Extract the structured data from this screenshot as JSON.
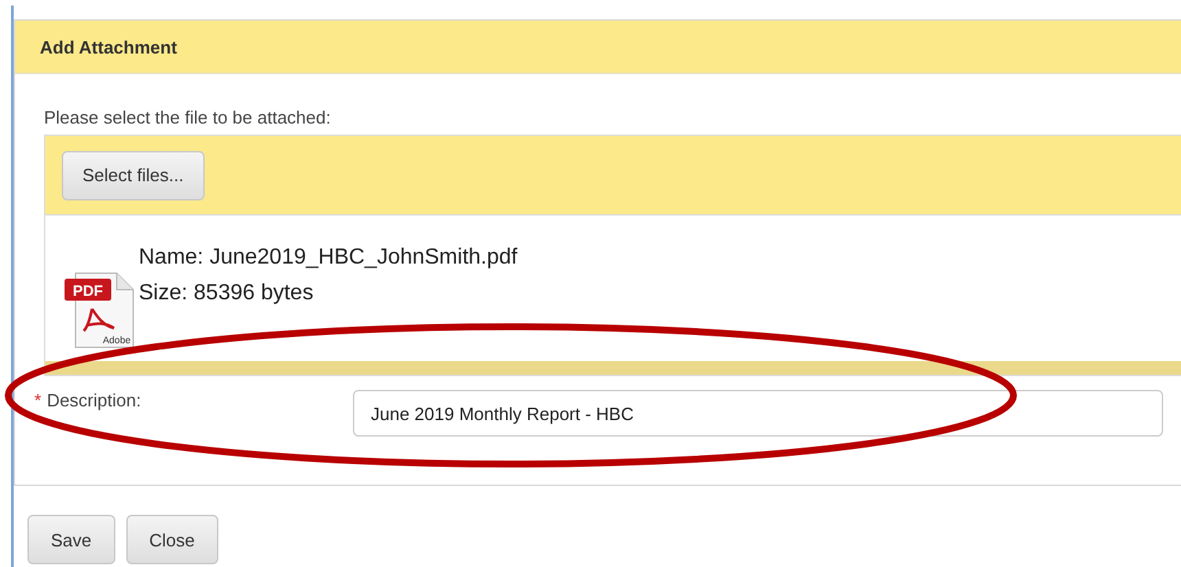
{
  "dialog": {
    "title": "Add Attachment"
  },
  "upload": {
    "prompt": "Please select the file to be attached:",
    "select_button": "Select files...",
    "file": {
      "icon_label": "PDF",
      "icon_brand": "Adobe",
      "name": "Name: June2019_HBC_JohnSmith.pdf",
      "size": "Size: 85396 bytes"
    }
  },
  "description": {
    "required_mark": "*",
    "label": "Description:",
    "value": "June 2019 Monthly Report - HBC"
  },
  "buttons": [
    "Save",
    "Close"
  ]
}
